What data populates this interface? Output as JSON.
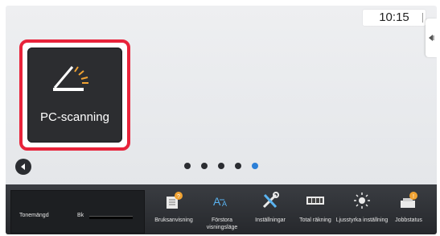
{
  "status_bar": {
    "time": "10:15"
  },
  "home": {
    "tile": {
      "label": "PC-scanning",
      "icon": "scanner-icon"
    },
    "pager": {
      "page_count": 5,
      "current_page": 5
    }
  },
  "taskbar": {
    "toner": {
      "label": "Tonemängd",
      "channel": "Bk",
      "level_fraction": 1.0
    },
    "buttons": [
      {
        "label": "Bruksanvisning",
        "icon": "manual-icon"
      },
      {
        "label": "Förstora visningsläge",
        "icon": "zoom-text-icon"
      },
      {
        "label": "Inställningar",
        "icon": "settings-tools-icon"
      },
      {
        "label": "Total räkning",
        "icon": "counter-icon"
      },
      {
        "label": "Ljusstyrka inställning",
        "icon": "brightness-icon"
      },
      {
        "label": "Jobbstatus",
        "icon": "job-status-icon"
      }
    ]
  },
  "colors": {
    "highlight": "#e8233a",
    "active_dot": "#2b7fd7"
  }
}
